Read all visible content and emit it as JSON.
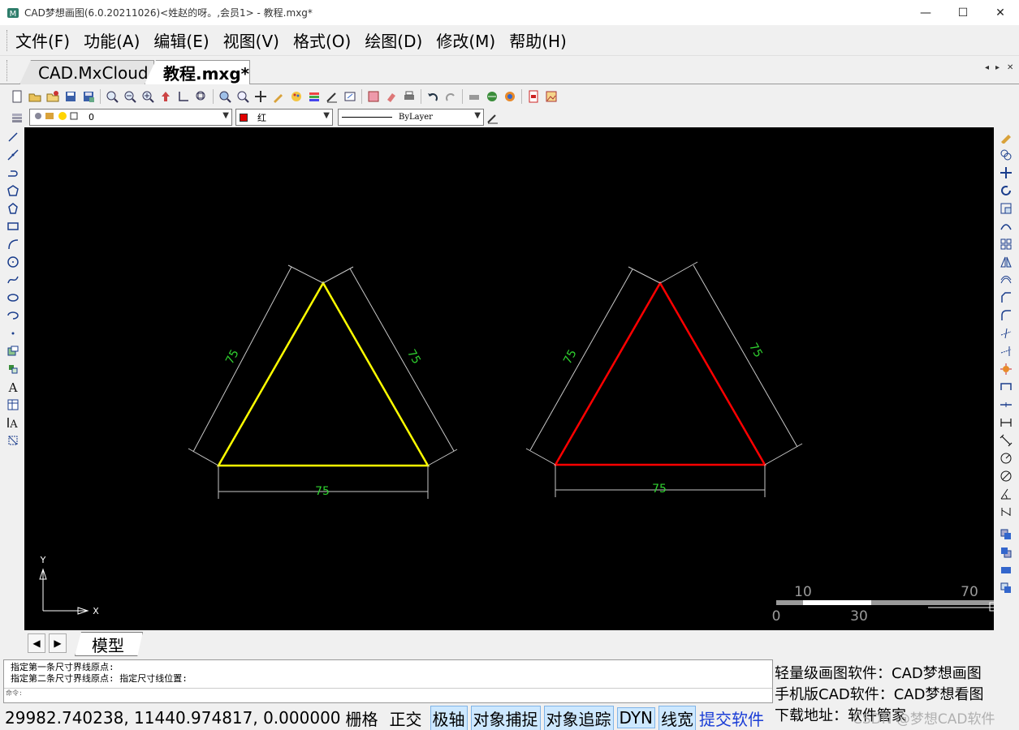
{
  "window": {
    "title": "CAD梦想画图(6.0.20211026)<姓赵的呀。,会员1> - 教程.mxg*",
    "minimize": "—",
    "maximize": "☐",
    "close": "✕"
  },
  "menu": {
    "items": [
      "文件(F)",
      "功能(A)",
      "编辑(E)",
      "视图(V)",
      "格式(O)",
      "绘图(D)",
      "修改(M)",
      "帮助(H)"
    ]
  },
  "tabs": {
    "items": [
      "CAD.MxCloud",
      "教程.mxg*"
    ],
    "prev": "◂",
    "next": "▸",
    "close": "✕"
  },
  "properties": {
    "layer": "0",
    "color": "红",
    "color_hex": "#e00000",
    "linetype": "ByLayer"
  },
  "drawing": {
    "background": "#000000",
    "triangle_left_color": "#ffff00",
    "triangle_right_color": "#ff0000",
    "dimension_color": "#2fd12f",
    "dimension_line_color": "#c8c8c8",
    "dim_left_a": "75",
    "dim_left_b": "75",
    "dim_left_base": "75",
    "dim_right_a": "75",
    "dim_right_b": "75",
    "dim_right_base": "75",
    "ucs_x": "X",
    "ucs_y": "Y",
    "scale_top_left": "10",
    "scale_top_right": "70",
    "scale_bottom_left": "0",
    "scale_bottom_mid": "30"
  },
  "layout": {
    "model_tab": "模型",
    "prev": "◀",
    "next": "▶"
  },
  "command": {
    "line1": "指定第一条尺寸界线原点:",
    "line2": "指定第二条尺寸界线原点: 指定尺寸线位置:",
    "prompt": "命令:"
  },
  "status": {
    "coords": "29982.740238,  11440.974817,  0.000000",
    "grid": "栅格",
    "ortho": "正交",
    "polar": "极轴",
    "osnap": "对象捕捉",
    "otrack": "对象追踪",
    "dyn": "DYN",
    "lineweight": "线宽",
    "submit": "提交软件"
  },
  "ads": {
    "line1": "轻量级画图软件：CAD梦想画图",
    "line2": "手机版CAD软件：CAD梦想看图",
    "line3": "下载地址：软件管家",
    "watermark": "CSDN @梦想CAD软件"
  }
}
